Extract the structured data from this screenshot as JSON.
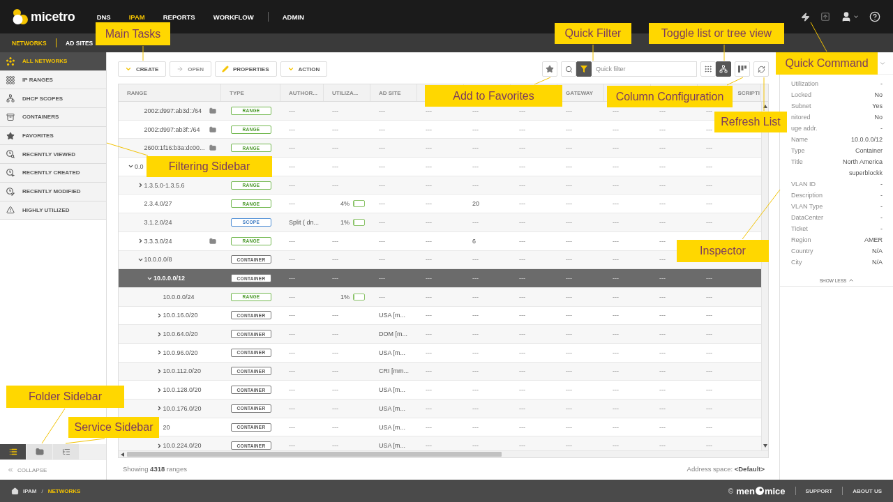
{
  "app": {
    "name": "micetro"
  },
  "nav": [
    {
      "label": "DNS",
      "selected": false
    },
    {
      "label": "IPAM",
      "selected": true
    },
    {
      "label": "REPORTS",
      "selected": false
    },
    {
      "label": "WORKFLOW",
      "selected": false
    },
    {
      "label": "ADMIN",
      "selected": false,
      "divider_before": true
    }
  ],
  "subnav": [
    {
      "label": "NETWORKS",
      "selected": true
    },
    {
      "label": "AD SITES",
      "selected": false
    }
  ],
  "sidebar": {
    "items": [
      {
        "label": "ALL NETWORKS",
        "selected": true
      },
      {
        "label": "IP RANGES",
        "selected": false
      },
      {
        "label": "DHCP SCOPES",
        "selected": false
      },
      {
        "label": "CONTAINERS",
        "selected": false
      },
      {
        "label": "FAVORITES",
        "selected": false
      },
      {
        "label": "RECENTLY VIEWED",
        "selected": false
      },
      {
        "label": "RECENTLY CREATED",
        "selected": false
      },
      {
        "label": "RECENTLY MODIFIED",
        "selected": false
      },
      {
        "label": "HIGHLY UTILIZED",
        "selected": false
      }
    ],
    "panel_tabs": [
      {
        "kind": "list",
        "selected": true
      },
      {
        "kind": "folder",
        "selected": false
      },
      {
        "kind": "service",
        "selected": false
      }
    ],
    "collapse": "COLLAPSE"
  },
  "toolbar": {
    "actions": [
      {
        "label": "CREATE",
        "kind": "menu",
        "disabled": false
      },
      {
        "label": "OPEN",
        "kind": "open",
        "disabled": true
      },
      {
        "label": "PROPERTIES",
        "kind": "edit",
        "disabled": false
      },
      {
        "label": "ACTION",
        "kind": "menu",
        "disabled": false
      }
    ],
    "quick_filter": {
      "placeholder": "Quick filter",
      "filter_on": true
    },
    "view_modes": [
      {
        "kind": "list",
        "selected": false
      },
      {
        "kind": "tree",
        "selected": true
      }
    ]
  },
  "table": {
    "columns": [
      {
        "label": "RANGE"
      },
      {
        "label": "TYPE"
      },
      {
        "label": "AUTHOR..."
      },
      {
        "label": "UTILIZA..."
      },
      {
        "label": "AD SITE"
      },
      {},
      {},
      {},
      {
        "label": "GATEWAY"
      },
      {},
      {},
      {
        "label": "SCRIPTI"
      }
    ],
    "rows": [
      {
        "children": [
          {
            "range": "2002:d997:ab3d::/64",
            "folder": true,
            "selected": false,
            "type": {
              "kind": "range",
              "label": "RANGE"
            },
            "author": "---",
            "utilization": {
              "text": "---"
            },
            "cells": [
              "---",
              "---",
              "---",
              "---",
              "---",
              "---",
              "---",
              "---"
            ]
          },
          {
            "range": "2002:d997:ab3f::/64",
            "folder": true,
            "selected": false,
            "type": {
              "kind": "range",
              "label": "RANGE"
            },
            "author": "---",
            "utilization": {
              "text": "---"
            },
            "cells": [
              "---",
              "---",
              "---",
              "---",
              "---",
              "---",
              "---",
              "---"
            ]
          },
          {
            "range": "2600:1f16:b3a:dc00...",
            "folder": true,
            "selected": false,
            "type": {
              "kind": "range",
              "label": "RANGE"
            },
            "author": "---",
            "utilization": {
              "text": "---"
            },
            "cells": [
              "---",
              "---",
              "---",
              "---",
              "---",
              "---",
              "---",
              "---"
            ]
          }
        ]
      },
      {
        "range": "0.0",
        "expanded": true,
        "selected": false,
        "author": "---",
        "utilization": {
          "text": "---"
        },
        "cells": [
          "---",
          "---",
          "---",
          "---",
          "---",
          "---",
          "---",
          "---"
        ],
        "children": [
          {
            "range": "1.3.5.0-1.3.5.6",
            "expanded": false,
            "selected": false,
            "type": {
              "kind": "range",
              "label": "RANGE"
            },
            "author": "---",
            "utilization": {
              "text": "---"
            },
            "cells": [
              "---",
              "---",
              "---",
              "---",
              "---",
              "---",
              "---",
              "---"
            ]
          },
          {
            "range": "2.3.4.0/27",
            "selected": false,
            "type": {
              "kind": "range",
              "label": "RANGE"
            },
            "author": "---",
            "utilization": {
              "text": "4%",
              "level": 0.04
            },
            "cells": [
              "---",
              "---",
              "20",
              "---",
              "---",
              "---",
              "---",
              "---"
            ]
          },
          {
            "range": "3.1.2.0/24",
            "selected": false,
            "type": {
              "kind": "scope",
              "label": "SCOPE"
            },
            "author": "Split ( dn...",
            "utilization": {
              "text": "1%",
              "level": 0.01
            },
            "cells": [
              "---",
              "---",
              "---",
              "---",
              "---",
              "---",
              "---",
              "---"
            ]
          },
          {
            "range": "3.3.3.0/24",
            "expanded": false,
            "folder": true,
            "selected": false,
            "type": {
              "kind": "range",
              "label": "RANGE"
            },
            "author": "---",
            "utilization": {
              "text": "---"
            },
            "cells": [
              "---",
              "---",
              "6",
              "---",
              "---",
              "---",
              "---",
              null
            ]
          },
          {
            "range": "10.0.0.0/8",
            "expanded": true,
            "selected": false,
            "type": {
              "kind": "container",
              "label": "CONTAINER"
            },
            "author": "---",
            "utilization": {
              "text": "---"
            },
            "cells": [
              "---",
              "---",
              "---",
              "---",
              "---",
              "---",
              "---",
              null
            ],
            "children": [
              {
                "range": "10.0.0.0/12",
                "expanded": true,
                "selected": true,
                "type": {
                  "kind": "container",
                  "label": "CONTAINER"
                },
                "author": "---",
                "utilization": {
                  "text": "---"
                },
                "cells": [
                  "---",
                  "---",
                  "---",
                  "---",
                  "---",
                  "---",
                  "---",
                  "---"
                ],
                "children": [
                  {
                    "range": "10.0.0.0/24",
                    "selected": false,
                    "type": {
                      "kind": "range",
                      "label": "RANGE"
                    },
                    "author": "---",
                    "utilization": {
                      "text": "1%",
                      "level": 0.01
                    },
                    "cells": [
                      "---",
                      "---",
                      "---",
                      "---",
                      "---",
                      "---",
                      "---",
                      "---"
                    ]
                  },
                  {
                    "range": "10.0.16.0/20",
                    "expanded": false,
                    "selected": false,
                    "type": {
                      "kind": "container",
                      "label": "CONTAINER"
                    },
                    "author": "---",
                    "utilization": {
                      "text": "---"
                    },
                    "cells": [
                      "USA [m...",
                      "---",
                      "---",
                      "---",
                      "---",
                      "---",
                      "---",
                      "---"
                    ]
                  },
                  {
                    "range": "10.0.64.0/20",
                    "expanded": false,
                    "selected": false,
                    "type": {
                      "kind": "container",
                      "label": "CONTAINER"
                    },
                    "author": "---",
                    "utilization": {
                      "text": "---"
                    },
                    "cells": [
                      "DOM [m...",
                      "---",
                      "---",
                      "---",
                      "---",
                      "---",
                      "---",
                      "---"
                    ]
                  },
                  {
                    "range": "10.0.96.0/20",
                    "expanded": false,
                    "selected": false,
                    "type": {
                      "kind": "container",
                      "label": "CONTAINER"
                    },
                    "author": "---",
                    "utilization": {
                      "text": "---"
                    },
                    "cells": [
                      "USA [m...",
                      "---",
                      "---",
                      "---",
                      "---",
                      "---",
                      "---",
                      "---"
                    ]
                  },
                  {
                    "range": "10.0.112.0/20",
                    "expanded": false,
                    "selected": false,
                    "type": {
                      "kind": "container",
                      "label": "CONTAINER"
                    },
                    "author": "---",
                    "utilization": {
                      "text": "---"
                    },
                    "cells": [
                      "CRI [mm...",
                      "---",
                      "---",
                      "---",
                      "---",
                      "---",
                      "---",
                      "---"
                    ]
                  },
                  {
                    "range": "10.0.128.0/20",
                    "expanded": false,
                    "selected": false,
                    "type": {
                      "kind": "container",
                      "label": "CONTAINER"
                    },
                    "author": "---",
                    "utilization": {
                      "text": "---"
                    },
                    "cells": [
                      "USA [m...",
                      "---",
                      "---",
                      "---",
                      "---",
                      "---",
                      "---",
                      "---"
                    ]
                  },
                  {
                    "range": "10.0.176.0/20",
                    "expanded": false,
                    "selected": false,
                    "type": {
                      "kind": "container",
                      "label": "CONTAINER"
                    },
                    "author": "---",
                    "utilization": {
                      "text": "---"
                    },
                    "cells": [
                      "USA [m...",
                      "---",
                      "---",
                      "---",
                      "---",
                      "---",
                      "---",
                      "---"
                    ]
                  },
                  {
                    "range": "20",
                    "selected": false,
                    "type": {
                      "kind": "container",
                      "label": "CONTAINER"
                    },
                    "author": "---",
                    "utilization": {
                      "text": "---"
                    },
                    "cells": [
                      "USA [m...",
                      "---",
                      "---",
                      "---",
                      "---",
                      "---",
                      "---",
                      "---"
                    ]
                  },
                  {
                    "range": "10.0.224.0/20",
                    "expanded": false,
                    "selected": false,
                    "type": {
                      "kind": "container",
                      "label": "CONTAINER"
                    },
                    "author": "---",
                    "utilization": {
                      "text": "---"
                    },
                    "cells": [
                      "USA [m...",
                      "---",
                      "---",
                      "---",
                      "---",
                      "---",
                      "---",
                      "---"
                    ]
                  }
                ]
              }
            ]
          }
        ]
      }
    ],
    "footer": {
      "count": "Showing **4318** ranges",
      "address_space": "Address space: **<Default>**"
    }
  },
  "inspector": {
    "rows": [
      {
        "label": "Utilization",
        "value": "-"
      },
      {
        "label": "Locked",
        "value": "No"
      },
      {
        "label": "Subnet",
        "value": "Yes"
      },
      {
        "label": "nitored",
        "value": "No"
      },
      {
        "label": "uge addr.",
        "value": "-"
      },
      {
        "label": "Name",
        "value": "10.0.0.0/12"
      },
      {
        "label": "Type",
        "value": "Container"
      },
      {
        "label": "Title",
        "value": "North America superblockk"
      },
      {
        "label": "VLAN ID",
        "value": "-"
      },
      {
        "label": "Description",
        "value": "-"
      },
      {
        "label": "VLAN Type",
        "value": "-"
      },
      {
        "label": "DataCenter",
        "value": "-"
      },
      {
        "label": "Ticket",
        "value": "-"
      },
      {
        "label": "Region",
        "value": "AMER"
      },
      {
        "label": "Country",
        "value": "N/A"
      },
      {
        "label": "City",
        "value": "N/A"
      }
    ],
    "toggle": "SHOW LESS"
  },
  "status_bar": {
    "breadcrumb": [
      {
        "label": "IPAM",
        "current": false
      },
      {
        "label": "NETWORKS",
        "current": true
      }
    ],
    "separator": "/",
    "copyright": "©",
    "brand": [
      "men",
      "mice"
    ],
    "links": [
      "SUPPORT",
      "ABOUT US"
    ]
  },
  "callouts": [
    {
      "text": "Main Tasks"
    },
    {
      "text": "Filtering Sidebar"
    },
    {
      "text": "Quick Filter"
    },
    {
      "text": "Toggle list or tree view"
    },
    {
      "text": "Quick Command"
    },
    {
      "text": "Add to Favorites"
    },
    {
      "text": "Column Configuration"
    },
    {
      "text": "Refresh List"
    },
    {
      "text": "Inspector"
    },
    {
      "text": "Folder Sidebar"
    },
    {
      "text": "Service Sidebar"
    }
  ]
}
